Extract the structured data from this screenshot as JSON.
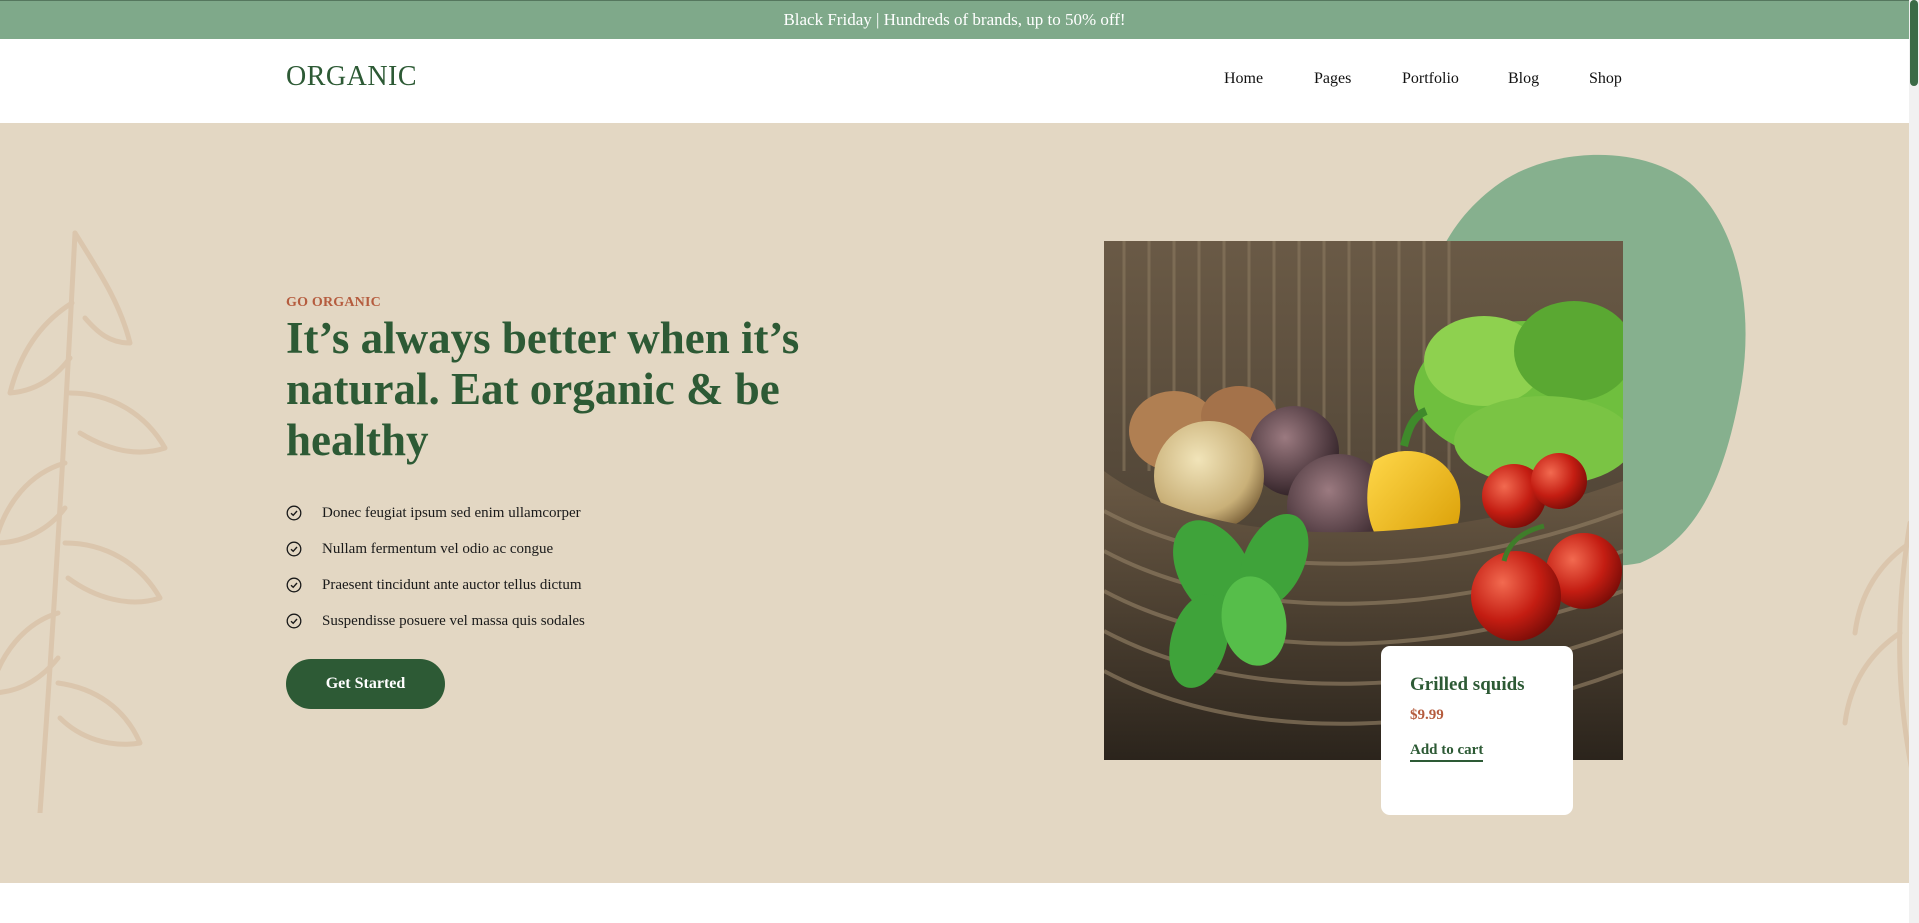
{
  "announcement": {
    "text": "Black Friday | Hundreds of brands, up to 50% off!"
  },
  "header": {
    "logo": "ORGANIC",
    "nav": [
      "Home",
      "Pages",
      "Portfolio",
      "Blog",
      "Shop"
    ]
  },
  "hero": {
    "eyebrow": "GO ORGANIC",
    "headline": "It’s always better when it’s natural. Eat organic & be healthy",
    "features": [
      "Donec feugiat ipsum sed enim ullamcorper",
      "Nullam fermentum vel odio ac congue",
      "Praesent tincidunt ante auctor tellus dictum",
      "Suspendisse posuere vel massa quis sodales"
    ],
    "cta_label": "Get Started"
  },
  "product": {
    "name": "Grilled squids",
    "price": "$9.99",
    "add_to_cart": "Add to cart"
  },
  "colors": {
    "brand_green": "#2d5a35",
    "accent_rust": "#b55c3e",
    "topbar": "#7fa98a",
    "hero_bg": "#e3d7c3",
    "blob": "#86b08e"
  },
  "icons": {
    "feature_bullet": "check-circle-icon",
    "decoration": "leaf-outline-icon"
  }
}
